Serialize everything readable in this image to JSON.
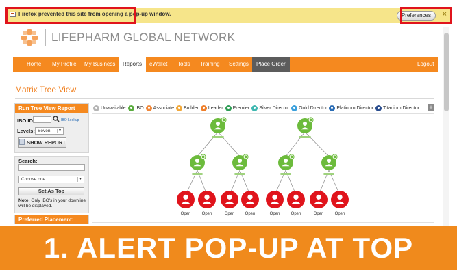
{
  "popup_bar": {
    "message": "Firefox prevented this site from opening a pop-up window.",
    "preferences_label": "Preferences",
    "close_glyph": "×",
    "highlight_color": "#e0141c"
  },
  "logo": {
    "name": "LIFEPHARM GLOBAL NETWORK"
  },
  "nav": {
    "items": [
      {
        "label": "Home"
      },
      {
        "label": "My Profile"
      },
      {
        "label": "My Business"
      },
      {
        "label": "Reports"
      },
      {
        "label": "eWallet"
      },
      {
        "label": "Tools"
      },
      {
        "label": "Training"
      },
      {
        "label": "Settings"
      },
      {
        "label": "Place Order"
      },
      {
        "label": "Logout"
      }
    ],
    "active": "Reports",
    "color": "#f5891f"
  },
  "page_title": "Matrix Tree View",
  "left_panel": {
    "run_title": "Run Tree View Report",
    "ibo_id_label": "IBO ID",
    "ibo_lookup_link": "IBO Lookup",
    "levels_label": "Levels:",
    "levels_value": "Seven",
    "show_report_label": "SHOW REPORT",
    "search_label": "Search:",
    "choose_placeholder": "Choose one...",
    "set_top_label": "Set As Top",
    "note_bold": "Note:",
    "note_text": "Only IBO's in your downline will be displayed.",
    "preferred_title": "Preferred Placement:"
  },
  "legend": {
    "items": [
      {
        "label": "Unavailable",
        "color": "#b5b5b5"
      },
      {
        "label": "IBO",
        "color": "#5aac3f"
      },
      {
        "label": "Associate",
        "color": "#f0883a"
      },
      {
        "label": "Builder",
        "color": "#f2a93b"
      },
      {
        "label": "Leader",
        "color": "#ef7f2a"
      },
      {
        "label": "Premier",
        "color": "#2f9e56"
      },
      {
        "label": "Silver Director",
        "color": "#3fb8b1"
      },
      {
        "label": "Gold Director",
        "color": "#3aa0dc"
      },
      {
        "label": "Platinum Director",
        "color": "#2b6db5"
      },
      {
        "label": "Titanium Director",
        "color": "#2a4d8f"
      }
    ],
    "expand_glyph": "+"
  },
  "tree": {
    "green": "#6cbb3c",
    "red": "#e0141c",
    "open_label": "Open"
  },
  "banner": {
    "text": "1. ALERT POP-UP AT TOP",
    "color": "#f08a1c"
  }
}
